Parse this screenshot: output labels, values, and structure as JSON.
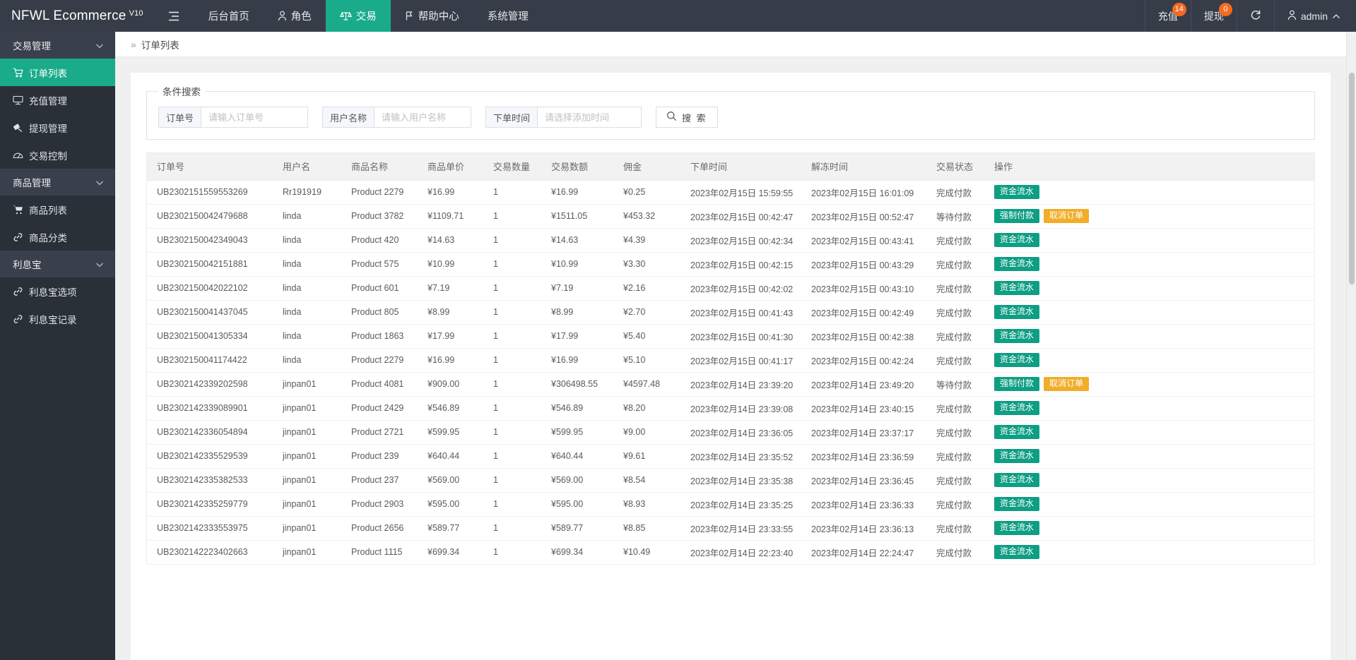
{
  "topbar": {
    "brand": "NFWL Ecommerce",
    "version": "V10",
    "menu_icon": "hamburger-icon",
    "nav": [
      {
        "label": "后台首页",
        "icon": "",
        "active": false
      },
      {
        "label": "角色",
        "icon": "user-icon",
        "active": false
      },
      {
        "label": "交易",
        "icon": "scales-icon",
        "active": true
      },
      {
        "label": "帮助中心",
        "icon": "flag-icon",
        "active": false
      },
      {
        "label": "系统管理",
        "icon": "",
        "active": false
      }
    ],
    "right": {
      "recharge_label": "充值",
      "recharge_badge": "14",
      "withdraw_label": "提现",
      "withdraw_badge": "0",
      "refresh_icon": "refresh-icon",
      "user_label": "admin",
      "user_icon": "user-icon",
      "caret_icon": "chevron-up-icon"
    },
    "colors": {
      "bar": "#373d48",
      "accent": "#1aab8a",
      "badge": "#f56a21"
    }
  },
  "sidebar": {
    "groups": [
      {
        "title": "交易管理",
        "items": [
          {
            "label": "订单列表",
            "icon": "cart-icon",
            "active": true
          },
          {
            "label": "充值管理",
            "icon": "monitor-icon",
            "active": false
          },
          {
            "label": "提现管理",
            "icon": "hammer-icon",
            "active": false
          },
          {
            "label": "交易控制",
            "icon": "gauge-icon",
            "active": false
          }
        ]
      },
      {
        "title": "商品管理",
        "items": [
          {
            "label": "商品列表",
            "icon": "cart-icon",
            "active": false
          },
          {
            "label": "商品分类",
            "icon": "link-icon",
            "active": false
          }
        ]
      },
      {
        "title": "利息宝",
        "items": [
          {
            "label": "利息宝选项",
            "icon": "link-icon",
            "active": false
          },
          {
            "label": "利息宝记录",
            "icon": "link-icon",
            "active": false
          }
        ]
      }
    ]
  },
  "breadcrumb": {
    "arrows": "»",
    "current": "订单列表"
  },
  "search": {
    "legend": "条件搜索",
    "order_no_label": "订单号",
    "order_no_placeholder": "请输入订单号",
    "order_no_value": "",
    "user_name_label": "用户名称",
    "user_name_placeholder": "请输入用户名称",
    "user_name_value": "",
    "order_time_label": "下单时间",
    "order_time_placeholder": "请选择添加时间",
    "order_time_value": "",
    "search_button": "搜 索",
    "search_icon": "search-icon"
  },
  "table": {
    "columns": [
      "订单号",
      "用户名",
      "商品名称",
      "商品单价",
      "交易数量",
      "交易数额",
      "佣金",
      "下单时间",
      "解冻时间",
      "交易状态",
      "操作"
    ],
    "rows": [
      {
        "order_no": "UB2302151559553269",
        "user": "Rr191919",
        "product": "Product 2279",
        "price": "¥16.99",
        "qty": "1",
        "amount": "¥16.99",
        "commission": "¥0.25",
        "order_time": "2023年02月15日 15:59:55",
        "unfreeze_time": "2023年02月15日 16:01:09",
        "status": "完成付款",
        "actions": [
          {
            "label": "资金流水",
            "style": "teal"
          }
        ]
      },
      {
        "order_no": "UB2302150042479688",
        "user": "linda",
        "product": "Product 3782",
        "price": "¥1109.71",
        "qty": "1",
        "amount": "¥1511.05",
        "commission": "¥453.32",
        "order_time": "2023年02月15日 00:42:47",
        "unfreeze_time": "2023年02月15日 00:52:47",
        "status": "等待付款",
        "actions": [
          {
            "label": "强制付款",
            "style": "teal"
          },
          {
            "label": "取消订单",
            "style": "orange"
          }
        ]
      },
      {
        "order_no": "UB2302150042349043",
        "user": "linda",
        "product": "Product 420",
        "price": "¥14.63",
        "qty": "1",
        "amount": "¥14.63",
        "commission": "¥4.39",
        "order_time": "2023年02月15日 00:42:34",
        "unfreeze_time": "2023年02月15日 00:43:41",
        "status": "完成付款",
        "actions": [
          {
            "label": "资金流水",
            "style": "teal"
          }
        ]
      },
      {
        "order_no": "UB2302150042151881",
        "user": "linda",
        "product": "Product 575",
        "price": "¥10.99",
        "qty": "1",
        "amount": "¥10.99",
        "commission": "¥3.30",
        "order_time": "2023年02月15日 00:42:15",
        "unfreeze_time": "2023年02月15日 00:43:29",
        "status": "完成付款",
        "actions": [
          {
            "label": "资金流水",
            "style": "teal"
          }
        ]
      },
      {
        "order_no": "UB2302150042022102",
        "user": "linda",
        "product": "Product 601",
        "price": "¥7.19",
        "qty": "1",
        "amount": "¥7.19",
        "commission": "¥2.16",
        "order_time": "2023年02月15日 00:42:02",
        "unfreeze_time": "2023年02月15日 00:43:10",
        "status": "完成付款",
        "actions": [
          {
            "label": "资金流水",
            "style": "teal"
          }
        ]
      },
      {
        "order_no": "UB2302150041437045",
        "user": "linda",
        "product": "Product 805",
        "price": "¥8.99",
        "qty": "1",
        "amount": "¥8.99",
        "commission": "¥2.70",
        "order_time": "2023年02月15日 00:41:43",
        "unfreeze_time": "2023年02月15日 00:42:49",
        "status": "完成付款",
        "actions": [
          {
            "label": "资金流水",
            "style": "teal"
          }
        ]
      },
      {
        "order_no": "UB2302150041305334",
        "user": "linda",
        "product": "Product 1863",
        "price": "¥17.99",
        "qty": "1",
        "amount": "¥17.99",
        "commission": "¥5.40",
        "order_time": "2023年02月15日 00:41:30",
        "unfreeze_time": "2023年02月15日 00:42:38",
        "status": "完成付款",
        "actions": [
          {
            "label": "资金流水",
            "style": "teal"
          }
        ]
      },
      {
        "order_no": "UB2302150041174422",
        "user": "linda",
        "product": "Product 2279",
        "price": "¥16.99",
        "qty": "1",
        "amount": "¥16.99",
        "commission": "¥5.10",
        "order_time": "2023年02月15日 00:41:17",
        "unfreeze_time": "2023年02月15日 00:42:24",
        "status": "完成付款",
        "actions": [
          {
            "label": "资金流水",
            "style": "teal"
          }
        ]
      },
      {
        "order_no": "UB2302142339202598",
        "user": "jinpan01",
        "product": "Product 4081",
        "price": "¥909.00",
        "qty": "1",
        "amount": "¥306498.55",
        "commission": "¥4597.48",
        "order_time": "2023年02月14日 23:39:20",
        "unfreeze_time": "2023年02月14日 23:49:20",
        "status": "等待付款",
        "actions": [
          {
            "label": "强制付款",
            "style": "teal"
          },
          {
            "label": "取消订单",
            "style": "orange"
          }
        ]
      },
      {
        "order_no": "UB2302142339089901",
        "user": "jinpan01",
        "product": "Product 2429",
        "price": "¥546.89",
        "qty": "1",
        "amount": "¥546.89",
        "commission": "¥8.20",
        "order_time": "2023年02月14日 23:39:08",
        "unfreeze_time": "2023年02月14日 23:40:15",
        "status": "完成付款",
        "actions": [
          {
            "label": "资金流水",
            "style": "teal"
          }
        ]
      },
      {
        "order_no": "UB2302142336054894",
        "user": "jinpan01",
        "product": "Product 2721",
        "price": "¥599.95",
        "qty": "1",
        "amount": "¥599.95",
        "commission": "¥9.00",
        "order_time": "2023年02月14日 23:36:05",
        "unfreeze_time": "2023年02月14日 23:37:17",
        "status": "完成付款",
        "actions": [
          {
            "label": "资金流水",
            "style": "teal"
          }
        ]
      },
      {
        "order_no": "UB2302142335529539",
        "user": "jinpan01",
        "product": "Product 239",
        "price": "¥640.44",
        "qty": "1",
        "amount": "¥640.44",
        "commission": "¥9.61",
        "order_time": "2023年02月14日 23:35:52",
        "unfreeze_time": "2023年02月14日 23:36:59",
        "status": "完成付款",
        "actions": [
          {
            "label": "资金流水",
            "style": "teal"
          }
        ]
      },
      {
        "order_no": "UB2302142335382533",
        "user": "jinpan01",
        "product": "Product 237",
        "price": "¥569.00",
        "qty": "1",
        "amount": "¥569.00",
        "commission": "¥8.54",
        "order_time": "2023年02月14日 23:35:38",
        "unfreeze_time": "2023年02月14日 23:36:45",
        "status": "完成付款",
        "actions": [
          {
            "label": "资金流水",
            "style": "teal"
          }
        ]
      },
      {
        "order_no": "UB2302142335259779",
        "user": "jinpan01",
        "product": "Product 2903",
        "price": "¥595.00",
        "qty": "1",
        "amount": "¥595.00",
        "commission": "¥8.93",
        "order_time": "2023年02月14日 23:35:25",
        "unfreeze_time": "2023年02月14日 23:36:33",
        "status": "完成付款",
        "actions": [
          {
            "label": "资金流水",
            "style": "teal"
          }
        ]
      },
      {
        "order_no": "UB2302142333553975",
        "user": "jinpan01",
        "product": "Product 2656",
        "price": "¥589.77",
        "qty": "1",
        "amount": "¥589.77",
        "commission": "¥8.85",
        "order_time": "2023年02月14日 23:33:55",
        "unfreeze_time": "2023年02月14日 23:36:13",
        "status": "完成付款",
        "actions": [
          {
            "label": "资金流水",
            "style": "teal"
          }
        ]
      },
      {
        "order_no": "UB2302142223402663",
        "user": "jinpan01",
        "product": "Product 1115",
        "price": "¥699.34",
        "qty": "1",
        "amount": "¥699.34",
        "commission": "¥10.49",
        "order_time": "2023年02月14日 22:23:40",
        "unfreeze_time": "2023年02月14日 22:24:47",
        "status": "完成付款",
        "actions": [
          {
            "label": "资金流水",
            "style": "teal"
          }
        ]
      }
    ]
  }
}
